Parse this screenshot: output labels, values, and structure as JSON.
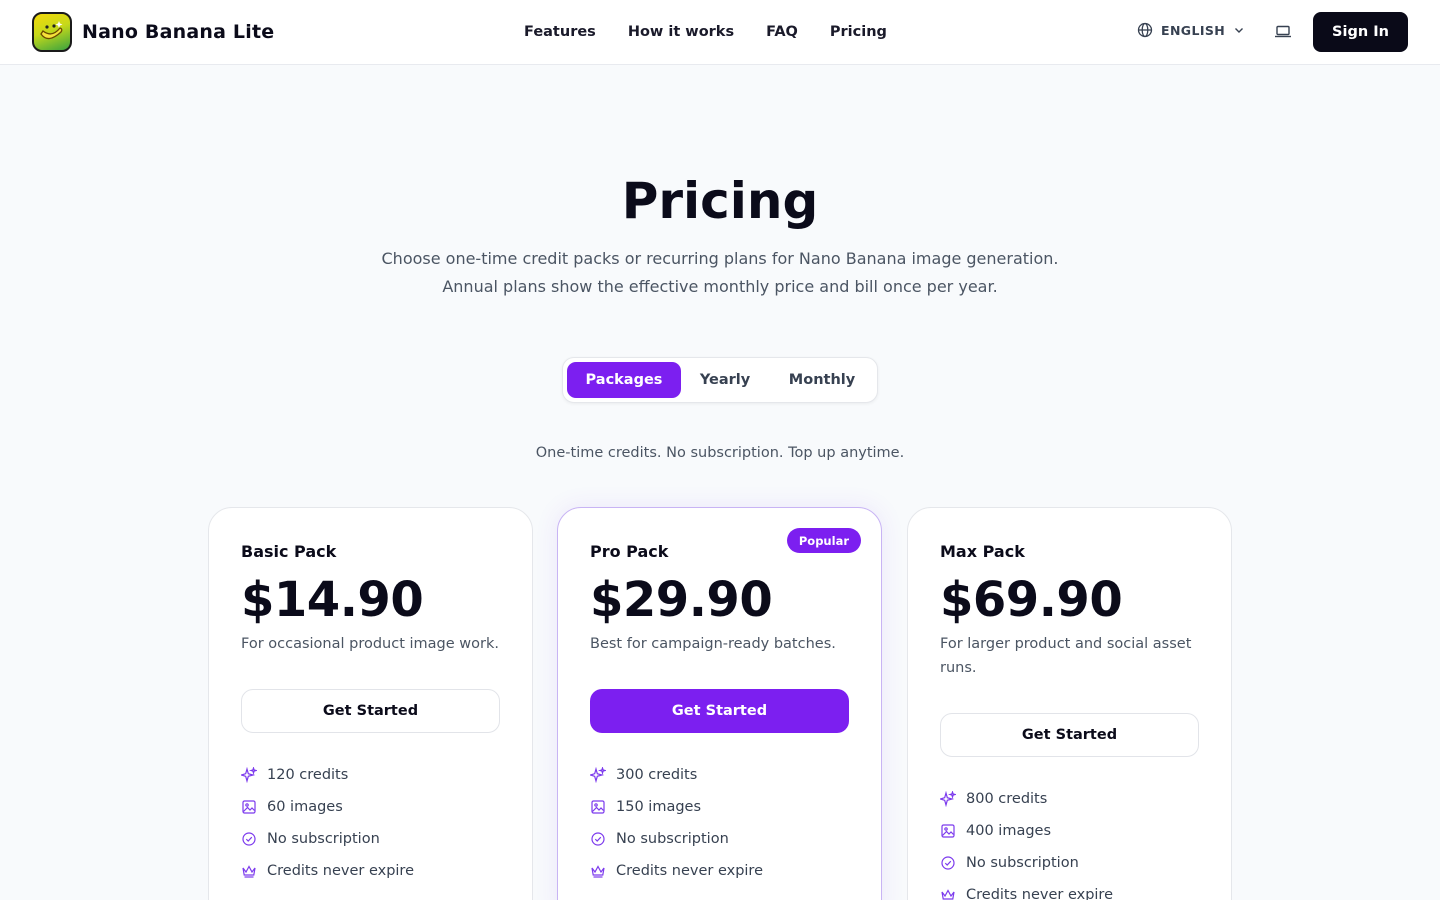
{
  "header": {
    "brand": "Nano Banana Lite",
    "nav": [
      "Features",
      "How it works",
      "FAQ",
      "Pricing"
    ],
    "language": "ENGLISH",
    "sign_in": "Sign In"
  },
  "hero": {
    "title": "Pricing",
    "subtitle": "Choose one-time credit packs or recurring plans for Nano Banana image generation. Annual plans show the effective monthly price and bill once per year."
  },
  "toggle": {
    "tabs": [
      "Packages",
      "Yearly",
      "Monthly"
    ],
    "active": "Packages"
  },
  "note": "One-time credits. No subscription. Top up anytime.",
  "colors": {
    "accent": "#7c1ff0",
    "dark": "#0a0a18",
    "icon": "#7c3aed"
  },
  "plans": [
    {
      "name": "Basic Pack",
      "price": "$14.90",
      "description": "For occasional product image work.",
      "cta": "Get Started",
      "features": [
        "120 credits",
        "60 images",
        "No subscription",
        "Credits never expire"
      ]
    },
    {
      "name": "Pro Pack",
      "price": "$29.90",
      "description": "Best for campaign-ready batches.",
      "cta": "Get Started",
      "badge": "Popular",
      "features": [
        "300 credits",
        "150 images",
        "No subscription",
        "Credits never expire"
      ]
    },
    {
      "name": "Max Pack",
      "price": "$69.90",
      "description": "For larger product and social asset runs.",
      "cta": "Get Started",
      "features": [
        "800 credits",
        "400 images",
        "No subscription",
        "Credits never expire"
      ]
    }
  ]
}
